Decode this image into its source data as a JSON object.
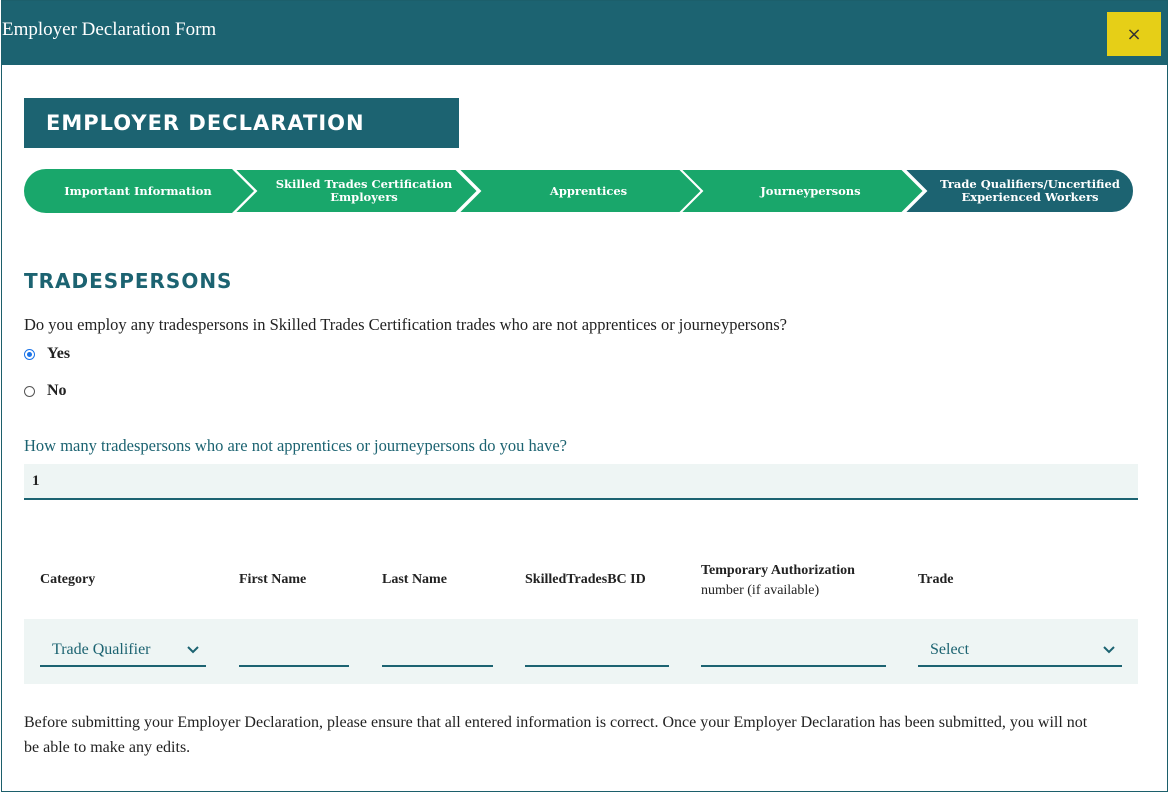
{
  "window": {
    "title": "Employer Declaration Form",
    "close_label": "×"
  },
  "page": {
    "heading": "EMPLOYER DECLARATION"
  },
  "stepper": {
    "steps": [
      {
        "label": "Important Information",
        "active": false
      },
      {
        "label": "Skilled Trades Certification Employers",
        "active": false
      },
      {
        "label": "Apprentices",
        "active": false
      },
      {
        "label": "Journeypersons",
        "active": false
      },
      {
        "label": "Trade Qualifiers/Uncertified Experienced Workers",
        "active": true
      }
    ],
    "colors": {
      "completed": "#19a76b",
      "active": "#1c6371"
    }
  },
  "section": {
    "title": "TRADESPERSONS",
    "question": "Do you employ any tradespersons in Skilled Trades Certification trades who are not apprentices or journeypersons?",
    "options": [
      {
        "label": "Yes",
        "checked": true
      },
      {
        "label": "No",
        "checked": false
      }
    ],
    "count_question": "How many tradespersons who are not apprentices or journeypersons do you have?",
    "count_value": "1"
  },
  "table": {
    "headers": {
      "category": "Category",
      "first_name": "First Name",
      "last_name": "Last Name",
      "id": "SkilledTradesBC ID",
      "temp_auth_line1": "Temporary Authorization",
      "temp_auth_line2": "number (if available)",
      "trade": "Trade"
    },
    "row": {
      "category": "Trade Qualifier",
      "first_name": "",
      "last_name": "",
      "id": "",
      "temp_auth": "",
      "trade": "Select"
    }
  },
  "footer": {
    "notice": "Before submitting your Employer Declaration, please ensure that all entered information is correct. Once your Employer Declaration has been submitted, you will not be able to make any edits."
  },
  "icons": {
    "close": "close-icon",
    "chevron": "chevron-down-icon"
  },
  "colors": {
    "brand": "#1c6371",
    "accent": "#e6cf17",
    "step_green": "#19a76b",
    "field_bg": "#eef5f4"
  }
}
